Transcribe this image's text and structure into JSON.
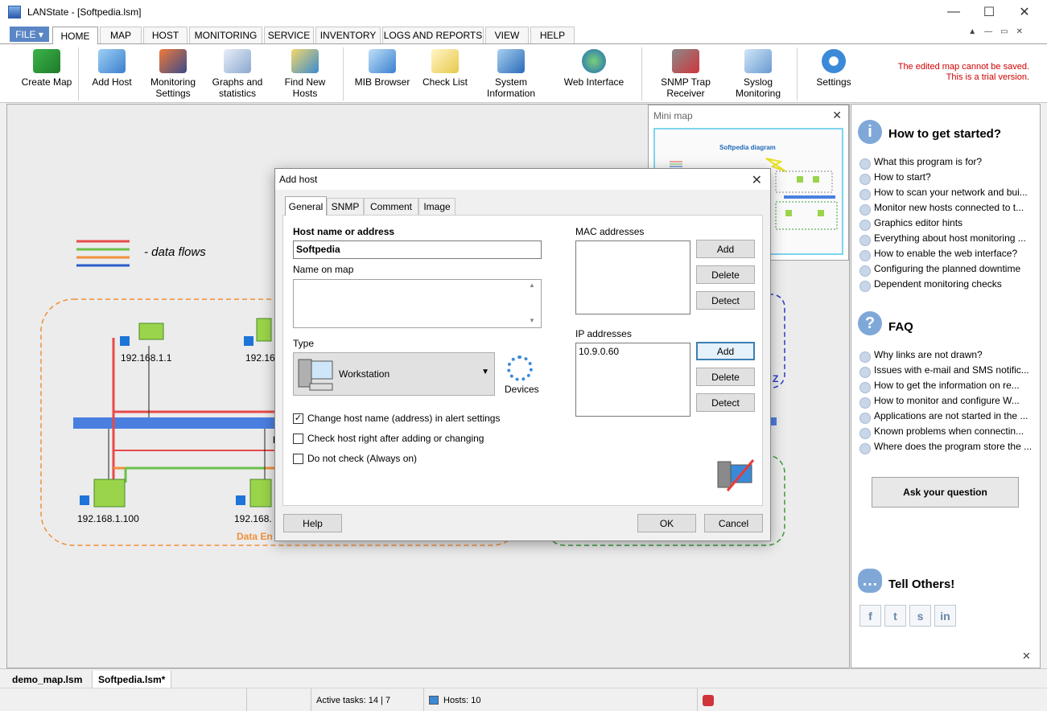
{
  "window": {
    "title": "LANState - [Softpedia.lsm]"
  },
  "ribbon_tabs": [
    {
      "label": "FILE"
    },
    {
      "label": "HOME"
    },
    {
      "label": "MAP"
    },
    {
      "label": "HOST"
    },
    {
      "label": "MONITORING"
    },
    {
      "label": "SERVICE"
    },
    {
      "label": "INVENTORY"
    },
    {
      "label": "LOGS AND REPORTS"
    },
    {
      "label": "VIEW"
    },
    {
      "label": "HELP"
    }
  ],
  "ribbon_buttons": [
    {
      "label": "Create Map",
      "icon": "create-map-icon"
    },
    {
      "label": "Add Host",
      "icon": "add-host-icon"
    },
    {
      "label": "Monitoring Settings",
      "icon": "monitoring-settings-icon"
    },
    {
      "label": "Graphs and statistics",
      "icon": "graphs-icon"
    },
    {
      "label": "Find New Hosts",
      "icon": "find-hosts-icon"
    },
    {
      "label": "MIB Browser",
      "icon": "mib-browser-icon"
    },
    {
      "label": "Check List",
      "icon": "check-list-icon"
    },
    {
      "label": "System Information",
      "icon": "system-info-icon"
    },
    {
      "label": "Web Interface",
      "icon": "globe-icon"
    },
    {
      "label": "SNMP Trap Receiver",
      "icon": "snmp-trap-icon"
    },
    {
      "label": "Syslog Monitoring",
      "icon": "syslog-icon"
    },
    {
      "label": "Settings",
      "icon": "gear-icon"
    }
  ],
  "trial_notice": {
    "line1": "The edited map cannot be saved.",
    "line2": "This is a trial version."
  },
  "map": {
    "legend_label": "- data flows",
    "hosts": [
      {
        "label": "192.168.1.1"
      },
      {
        "label": "192.16"
      },
      {
        "label": "192.168.1.100"
      },
      {
        "label": "192.168."
      }
    ],
    "zone_label": "Data En",
    "partial_z": "Z",
    "bus_label_fragment": "L"
  },
  "minimap": {
    "title": "Mini map",
    "diagram_title": "Softpedia diagram"
  },
  "dialog": {
    "title": "Add host",
    "tabs": [
      {
        "label": "General"
      },
      {
        "label": "SNMP"
      },
      {
        "label": "Comment"
      },
      {
        "label": "Image"
      }
    ],
    "host_name_label": "Host name or address",
    "host_name_value": "Softpedia",
    "name_on_map_label": "Name on map",
    "name_on_map_value": "",
    "type_label": "Type",
    "type_value": "Workstation",
    "devices_label": "Devices",
    "mac_label": "MAC addresses",
    "ip_label": "IP addresses",
    "ip_values": [
      "10.9.0.60"
    ],
    "btn_add": "Add",
    "btn_delete": "Delete",
    "btn_detect": "Detect",
    "checkboxes": [
      {
        "label": "Change host name (address) in alert settings",
        "checked": "✓"
      },
      {
        "label": "Check host right after adding or changing",
        "checked": ""
      },
      {
        "label": "Do not check (Always on)",
        "checked": ""
      }
    ],
    "btn_help": "Help",
    "btn_ok": "OK",
    "btn_cancel": "Cancel"
  },
  "right_panel": {
    "started_title": "How to get started?",
    "started_items": [
      "What this program is for?",
      "How to start?",
      "How to scan your network and bui...",
      "Monitor new hosts connected to t...",
      "Graphics editor hints",
      "Everything about host monitoring ...",
      "How to enable the web interface?",
      "Configuring the planned downtime",
      "Dependent monitoring checks"
    ],
    "faq_title": "FAQ",
    "faq_items": [
      "Why links are not drawn?",
      "Issues with e-mail and SMS notific...",
      "How to get the information on re...",
      "How to monitor and configure W...",
      "Applications are not started in the ...",
      "Known problems when connectin...",
      "Where does the program store the ..."
    ],
    "ask_button": "Ask your question",
    "tell_title": "Tell Others!",
    "social": [
      "f",
      "t",
      "s",
      "in"
    ]
  },
  "doc_tabs": [
    {
      "label": "demo_map.lsm"
    },
    {
      "label": "Softpedia.lsm*"
    }
  ],
  "status": {
    "active_tasks": "Active tasks: 14 | 7",
    "hosts": "Hosts: 10"
  },
  "colors": {
    "accent": "#5a86c6",
    "flow_red": "#e84a4a",
    "flow_green": "#6cc04a",
    "flow_orange": "#f0903a",
    "flow_blue": "#2a5cc8",
    "bus": "#4a7fe0",
    "trial_red": "#d00000"
  }
}
